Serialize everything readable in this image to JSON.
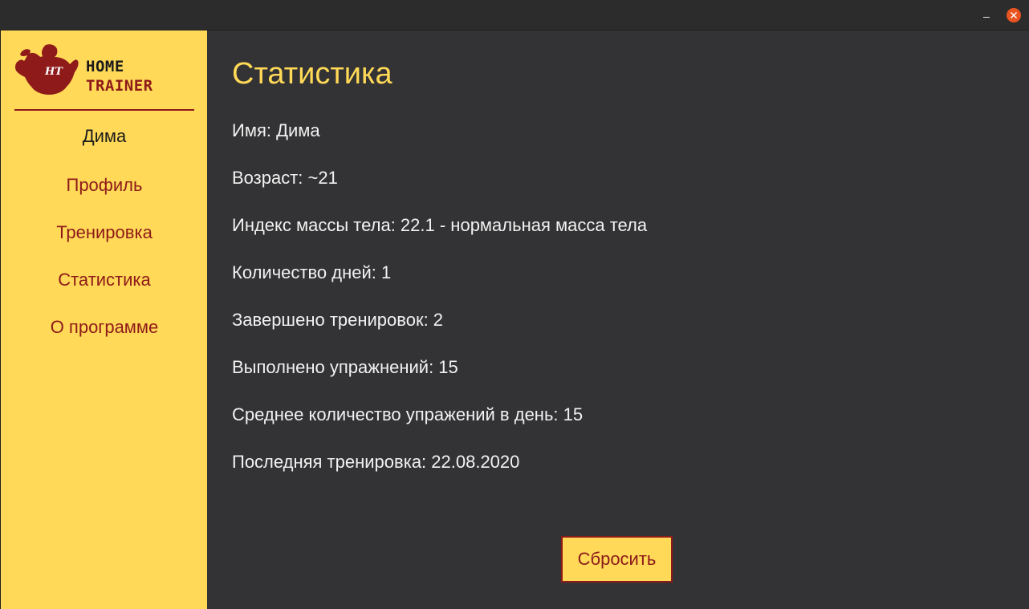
{
  "window": {
    "minimize_icon": "minimize-icon",
    "close_icon": "close-icon",
    "close_color": "#e95420"
  },
  "sidebar": {
    "logo": {
      "line1": "HOME",
      "line2": "TRAINER",
      "badge": "HT"
    },
    "user_name": "Дима",
    "items": [
      {
        "label": "Профиль"
      },
      {
        "label": "Тренировка"
      },
      {
        "label": "Статистика"
      },
      {
        "label": "О программе"
      }
    ],
    "accent": "#8e1a1a",
    "background": "#ffd957"
  },
  "main": {
    "title": "Статистика",
    "stats": [
      "Имя: Дима",
      "Возраст: ~21",
      "Индекс массы тела: 22.1 - нормальная масса тела",
      "Количество дней: 1",
      "Завершено тренировок: 2",
      "Выполнено упражнений: 15",
      "Среднее количество упражений в день: 15",
      "Последняя тренировка: 22.08.2020"
    ],
    "reset_label": "Сбросить",
    "background": "#333234",
    "title_color": "#ffd957"
  }
}
